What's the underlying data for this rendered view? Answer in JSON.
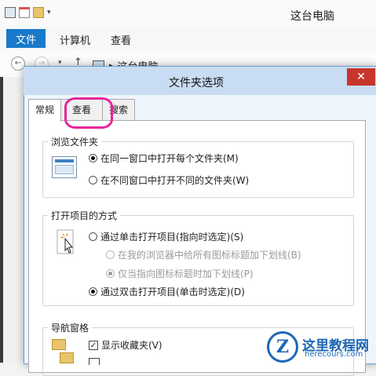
{
  "explorer": {
    "window_title": "这台电脑",
    "ribbon_tabs": [
      "文件",
      "计算机",
      "查看"
    ],
    "breadcrumb": "这台电脑"
  },
  "dialog": {
    "title": "文件夹选项",
    "close_glyph": "✕",
    "tabs": [
      "常规",
      "查看",
      "搜索"
    ],
    "active_tab": "常规",
    "groups": {
      "browse": {
        "title": "浏览文件夹",
        "options": [
          {
            "label": "在同一窗口中打开每个文件夹(M)",
            "selected": true
          },
          {
            "label": "在不同窗口中打开不同的文件夹(W)",
            "selected": false
          }
        ]
      },
      "open_items": {
        "title": "打开项目的方式",
        "single_click": "通过单击打开项目(指向时选定)(S)",
        "sub_options": [
          {
            "label": "在我的浏览器中给所有图标标题加下划线(B)",
            "selected": false
          },
          {
            "label": "仅当指向图标标题时加下划线(P)",
            "selected": true
          }
        ],
        "double_click": "通过双击打开项目(单击时选定)(D)"
      },
      "nav_pane": {
        "title": "导航窗格",
        "checkbox_label": "显示收藏夹(V)",
        "checked": true
      }
    }
  },
  "watermark": {
    "logo_letter": "Z",
    "name": "这里教程网",
    "url": "herecours.com"
  },
  "colors": {
    "file_tab": "#1979ca",
    "close_button": "#c7352c",
    "highlight": "#e8239a",
    "watermark": "#1c67b6"
  }
}
